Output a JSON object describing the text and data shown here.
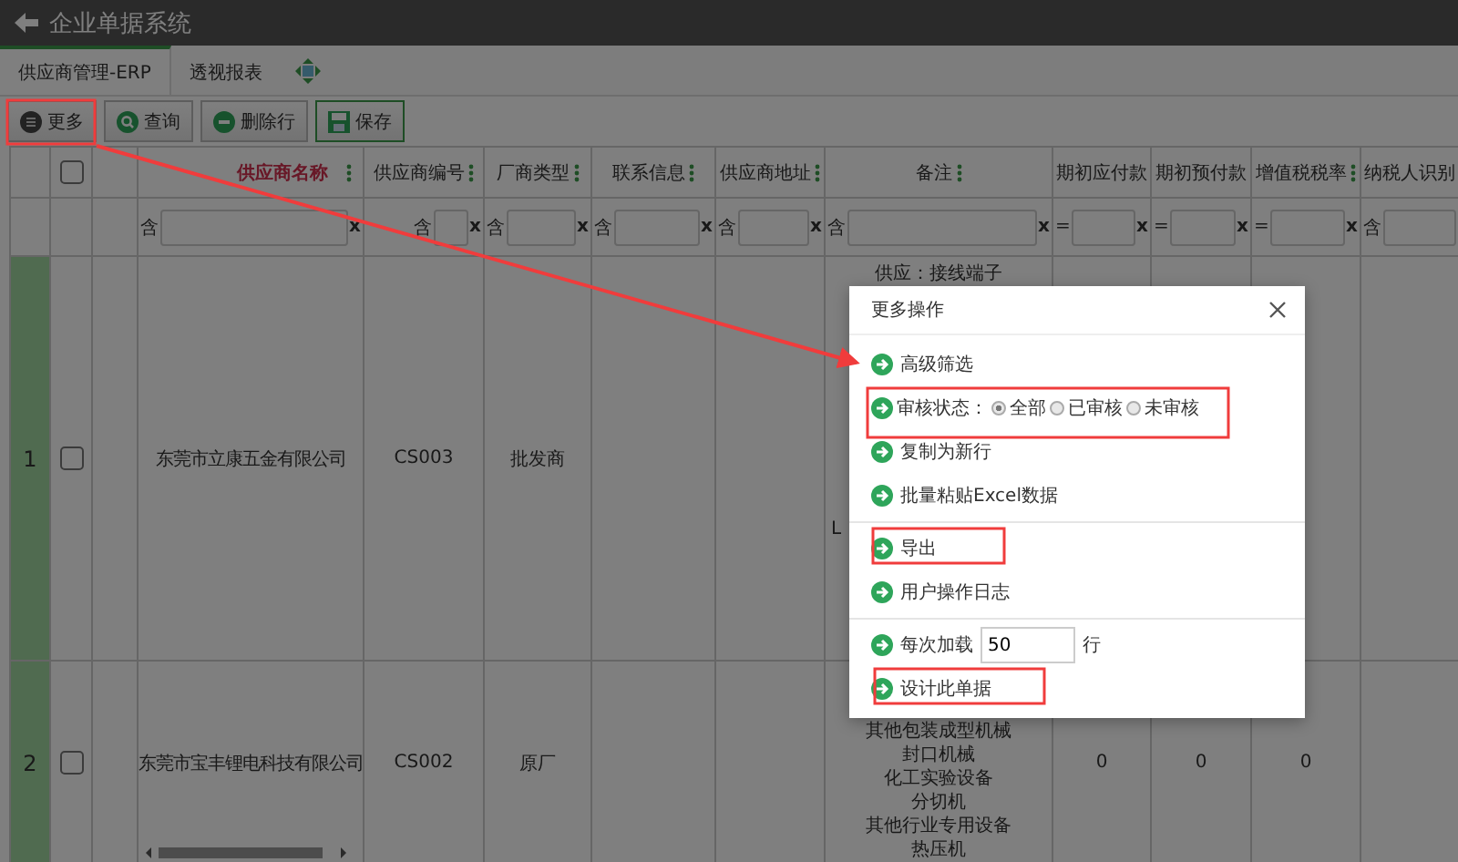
{
  "window": {
    "title": "企业单据系统"
  },
  "tabs": [
    {
      "label": "供应商管理-ERP",
      "selected": true
    },
    {
      "label": "透视报表",
      "selected": false
    }
  ],
  "toolbar": [
    {
      "kind": "more",
      "label": "更多"
    },
    {
      "kind": "search",
      "label": "查询"
    },
    {
      "kind": "remove",
      "label": "删除行"
    },
    {
      "kind": "save",
      "label": "保存"
    }
  ],
  "table": {
    "header_checked": false,
    "columns": [
      {
        "label": "供应商名称",
        "highlighted": true,
        "menu": true,
        "filter_op": "含",
        "clear": "x"
      },
      {
        "label": "供应商编号",
        "highlighted": false,
        "menu": true,
        "filter_op": "含",
        "clear": "x"
      },
      {
        "label": "厂商类型",
        "highlighted": false,
        "menu": true,
        "filter_op": "含",
        "clear": "x"
      },
      {
        "label": "联系信息",
        "highlighted": false,
        "menu": true,
        "filter_op": "含",
        "clear": "x"
      },
      {
        "label": "供应商地址",
        "highlighted": false,
        "menu": true,
        "filter_op": "含",
        "clear": "x"
      },
      {
        "label": "备注",
        "highlighted": false,
        "menu": true,
        "filter_op": "含",
        "clear": "x"
      },
      {
        "label": "期初应付款",
        "highlighted": false,
        "menu": false,
        "filter_op": "=",
        "clear": "x"
      },
      {
        "label": "期初预付款",
        "highlighted": false,
        "menu": false,
        "filter_op": "=",
        "clear": "x"
      },
      {
        "label": "增值税税率",
        "highlighted": false,
        "menu": true,
        "filter_op": "=",
        "clear": "x"
      },
      {
        "label": "纳税人识别",
        "highlighted": false,
        "menu": false,
        "filter_op": "含"
      }
    ],
    "rows": [
      {
        "number": "1",
        "checked": false,
        "name": "东莞市立康五金有限公司",
        "code": "CS003",
        "type": "批发商",
        "remark_lines": [
          "供应：接线端子",
          "L"
        ]
      },
      {
        "number": "2",
        "checked": false,
        "name": "东莞市宝丰锂电科技有限公司",
        "code": "CS002",
        "type": "原厂",
        "remark_lines": [
          "其他包装成型机械",
          "封口机械",
          "化工实验设备",
          "分切机",
          "其他行业专用设备",
          "热压机"
        ],
        "opening_payable": "0",
        "opening_prepaid": "0",
        "vat_rate": "0"
      }
    ]
  },
  "dialog": {
    "title": "更多操作",
    "groups": [
      [
        {
          "kind": "action",
          "label": "高级筛选"
        },
        {
          "kind": "radio",
          "label": "审核状态：",
          "options": [
            {
              "label": "全部",
              "selected": true
            },
            {
              "label": "已审核",
              "selected": false
            },
            {
              "label": "未审核",
              "selected": false
            }
          ]
        },
        {
          "kind": "action",
          "label": "复制为新行"
        },
        {
          "kind": "action",
          "label": "批量粘贴Excel数据"
        }
      ],
      [
        {
          "kind": "action",
          "label": "导出"
        },
        {
          "kind": "action",
          "label": "用户操作日志"
        }
      ],
      [
        {
          "kind": "input",
          "label": "每次加载",
          "value": "50",
          "unit": "行"
        },
        {
          "kind": "action",
          "label": "设计此单据"
        }
      ]
    ]
  }
}
